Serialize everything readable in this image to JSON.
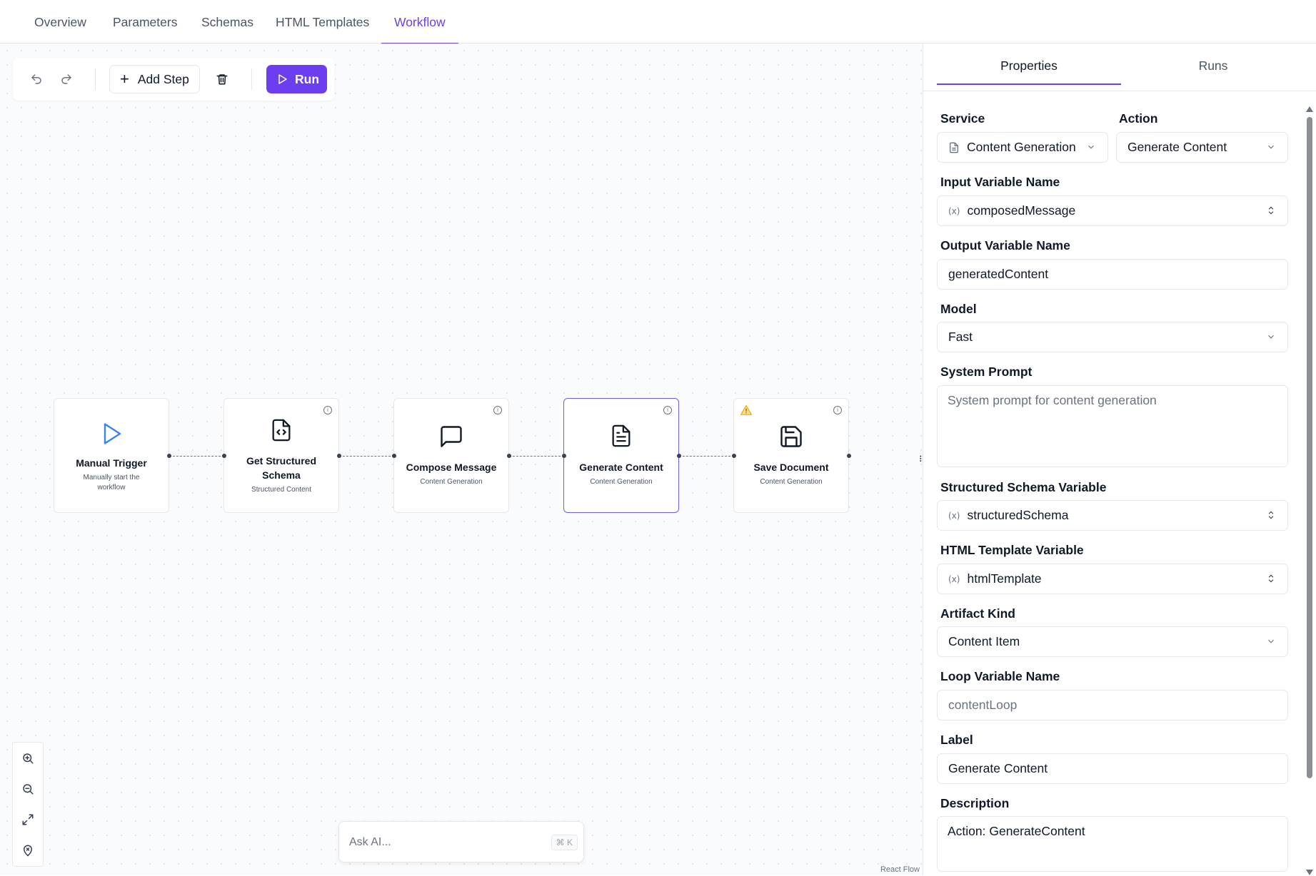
{
  "top_tabs": [
    "Overview",
    "Parameters",
    "Schemas",
    "HTML Templates",
    "Workflow"
  ],
  "active_top_tab": "Workflow",
  "toolbar": {
    "undo_icon": "undo-icon",
    "redo_icon": "redo-icon",
    "add_step_label": "Add Step",
    "delete_icon": "trash-icon",
    "run_label": "Run"
  },
  "nodes": [
    {
      "title": "Manual Trigger",
      "subtitle": "Manually start the workflow",
      "icon": "play-icon",
      "badge": ""
    },
    {
      "title": "Get Structured Schema",
      "subtitle": "Structured Content",
      "icon": "file-code-icon",
      "badge": "info"
    },
    {
      "title": "Compose Message",
      "subtitle": "Content Generation",
      "icon": "message-square-icon",
      "badge": "info"
    },
    {
      "title": "Generate Content",
      "subtitle": "Content Generation",
      "icon": "file-text-icon",
      "badge": "info",
      "selected": true
    },
    {
      "title": "Save Document",
      "subtitle": "Content Generation",
      "icon": "save-icon",
      "badge": "info+warning"
    }
  ],
  "ask_ai": {
    "placeholder": "Ask AI...",
    "shortcut": "⌘ K"
  },
  "attribution": "React Flow",
  "panel": {
    "tabs": [
      "Properties",
      "Runs"
    ],
    "active_tab": "Properties",
    "service": {
      "label": "Service",
      "value": "Content Generation"
    },
    "action": {
      "label": "Action",
      "value": "Generate Content"
    },
    "input_var": {
      "label": "Input Variable Name",
      "value": "composedMessage"
    },
    "output_var": {
      "label": "Output Variable Name",
      "value": "generatedContent"
    },
    "model": {
      "label": "Model",
      "value": "Fast"
    },
    "system_prompt": {
      "label": "System Prompt",
      "placeholder": "System prompt for content generation"
    },
    "schema_var": {
      "label": "Structured Schema Variable",
      "value": "structuredSchema"
    },
    "html_var": {
      "label": "HTML Template Variable",
      "value": "htmlTemplate"
    },
    "artifact_kind": {
      "label": "Artifact Kind",
      "value": "Content Item"
    },
    "loop_var": {
      "label": "Loop Variable Name",
      "placeholder": "contentLoop"
    },
    "label_field": {
      "label": "Label",
      "value": "Generate Content"
    },
    "description": {
      "label": "Description",
      "value": "Action: GenerateContent"
    }
  },
  "colors": {
    "accent": "#6d3ef0",
    "trigger_icon": "#3b82f6",
    "warning": "#f59e0b"
  }
}
